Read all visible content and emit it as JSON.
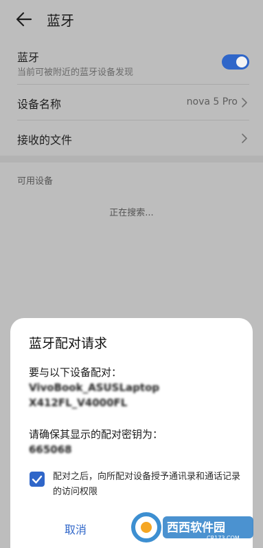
{
  "header": {
    "title": "蓝牙"
  },
  "bluetooth": {
    "label": "蓝牙",
    "subtitle": "当前可被附近的蓝牙设备发现",
    "enabled": true
  },
  "device_name": {
    "label": "设备名称",
    "value": "nova 5 Pro"
  },
  "received_files": {
    "label": "接收的文件"
  },
  "available": {
    "section_title": "可用设备",
    "status": "正在搜索..."
  },
  "dialog": {
    "title": "蓝牙配对请求",
    "pair_with_label": "要与以下设备配对：",
    "device_line1": "VivoBook_ASUSLaptop",
    "device_line2": "X412FL_V4000FL",
    "confirm_key_label": "请确保其显示的配对密钥为：",
    "pairing_key": "665068",
    "checkbox_checked": true,
    "checkbox_text": "配对之后，向所配对设备授予通讯录和通话记录的访问权限",
    "cancel_label": "取消"
  },
  "watermark": {
    "text": "西西软件园",
    "url": "CR173.COM"
  },
  "colors": {
    "accent": "#2f66c9",
    "background": "#bdbdbd",
    "dialog": "#ffffff"
  }
}
